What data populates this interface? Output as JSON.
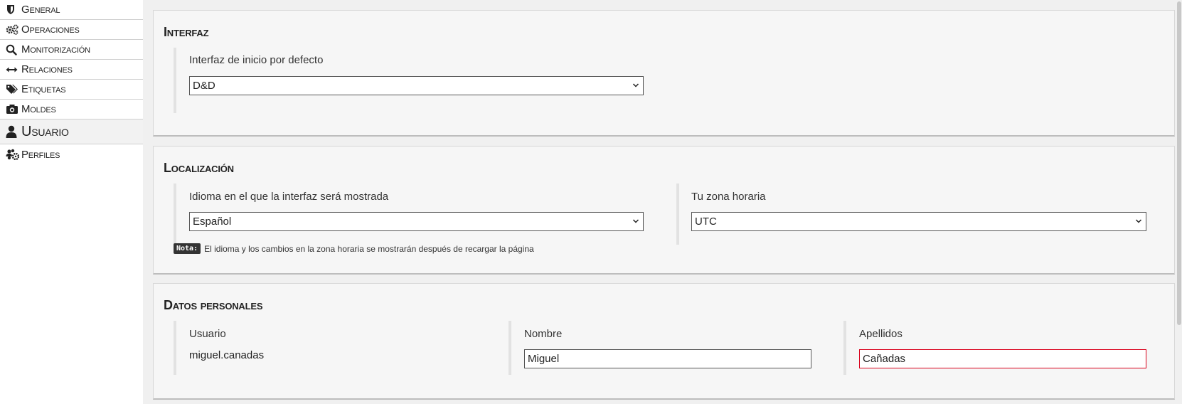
{
  "sidebar": {
    "items": [
      {
        "label": "General",
        "icon": "shield-icon"
      },
      {
        "label": "Operaciones",
        "icon": "gears-icon"
      },
      {
        "label": "Monitorización",
        "icon": "search-icon"
      },
      {
        "label": "Relaciones",
        "icon": "double-arrow-icon"
      },
      {
        "label": "Etiquetas",
        "icon": "tags-icon"
      },
      {
        "label": "Moldes",
        "icon": "camera-icon"
      },
      {
        "label": "Usuario",
        "icon": "user-icon",
        "active": true
      },
      {
        "label": "Perfiles",
        "icon": "users-gear-icon"
      }
    ]
  },
  "interfaz": {
    "title": "Interfaz",
    "start_label": "Interfaz de inicio por defecto",
    "start_value": "D&D"
  },
  "localizacion": {
    "title": "Localización",
    "language_label": "Idioma en el que la interfaz será mostrada",
    "language_value": "Español",
    "timezone_label": "Tu zona horaria",
    "timezone_value": "UTC",
    "note_tag": "Nota:",
    "note_text": "El idioma y los cambios en la zona horaria se mostrarán después de recargar la página"
  },
  "datos": {
    "title": "Datos personales",
    "user_label": "Usuario",
    "user_value": "miguel.canadas",
    "name_label": "Nombre",
    "name_value": "Miguel",
    "surname_label": "Apellidos",
    "surname_value": "Cañadas"
  },
  "colors": {
    "error_border": "#d9001b",
    "active_nav_bg": "#f2f2f2"
  }
}
